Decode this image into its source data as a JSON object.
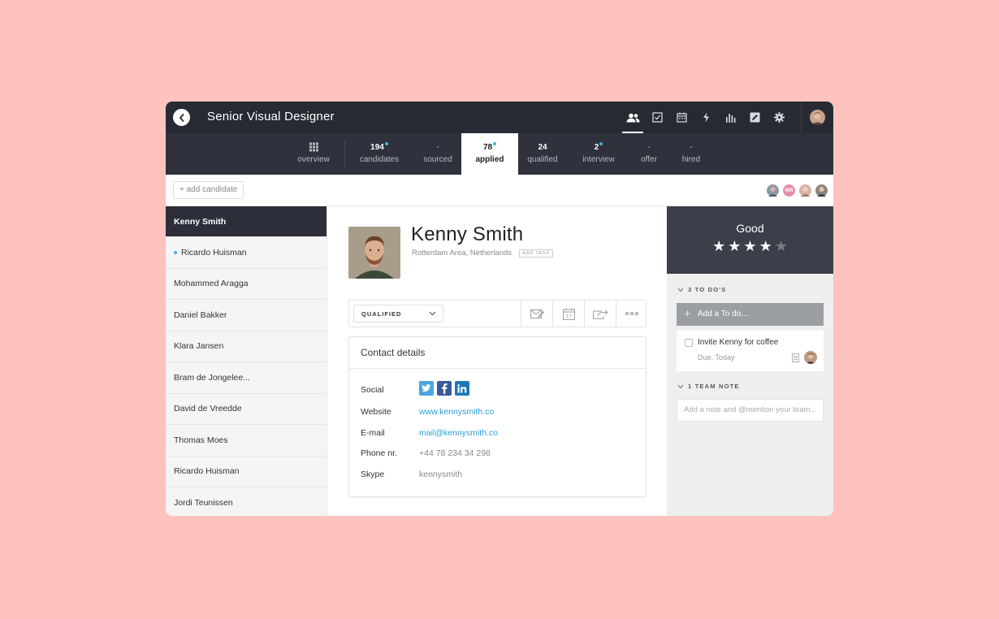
{
  "header": {
    "title": "Senior Visual Designer",
    "icons": [
      "people-icon",
      "checkbox-icon",
      "calendar-icon",
      "lightning-icon",
      "bar-chart-icon",
      "edit-icon",
      "gear-icon"
    ]
  },
  "stages": [
    {
      "count": "",
      "label": "overview"
    },
    {
      "count": "194",
      "label": "candidates"
    },
    {
      "count": "-",
      "label": "sourced"
    },
    {
      "count": "78",
      "label": "applied"
    },
    {
      "count": "24",
      "label": "qualified"
    },
    {
      "count": "2",
      "label": "interview"
    },
    {
      "count": "-",
      "label": "offer"
    },
    {
      "count": "-",
      "label": "hired"
    }
  ],
  "subbar": {
    "add_candidate": "+ add candidate",
    "team_initials": "WR"
  },
  "candidates": [
    "Kenny Smith",
    "Ricardo Huisman",
    "Mohammed Aragga",
    "Daniel Bakker",
    "Klara Jansen",
    "Bram de Jongelee...",
    "David de Vreedde",
    "Thomas Moes",
    "Ricardo Huisman",
    "Jordi Teunissen"
  ],
  "profile": {
    "name": "Kenny Smith",
    "location": "Rotterdam Area, Netherlands",
    "add_tags": "ADD TAGS",
    "status": "QUALIFIED"
  },
  "contact": {
    "heading": "Contact details",
    "social_label": "Social",
    "website_label": "Website",
    "website": "www.kennysmith.co",
    "email_label": "E-mail",
    "email": "mail@kennysmith.co",
    "phone_label": "Phone nr.",
    "phone": "+44 78 234 34 298",
    "skype_label": "Skype",
    "skype": "kennysmith"
  },
  "rating": {
    "word": "Good",
    "stars": 4,
    "max": 5
  },
  "todos": {
    "heading": "3 TO DO'S",
    "add_placeholder": "Add a To do...",
    "item_text": "Invite Kenny for coffee",
    "item_due": "Due, Today"
  },
  "notes": {
    "heading": "1 TEAM NOTE",
    "placeholder": "Add a note and @mention your team..."
  },
  "colors": {
    "background": "#ffc3bf",
    "topbar": "#272a33",
    "accent": "#3cb4e5",
    "link": "#2aa0d6"
  }
}
